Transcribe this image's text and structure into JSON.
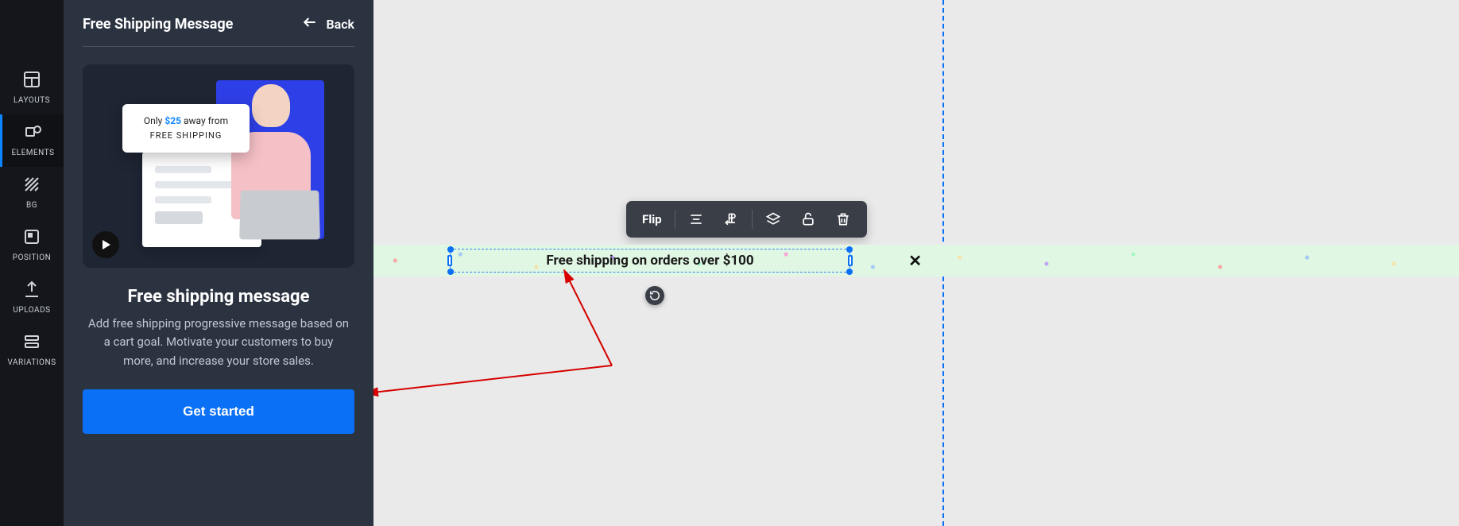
{
  "rail": {
    "items": [
      {
        "label": "LAYOUTS"
      },
      {
        "label": "ELEMENTS"
      },
      {
        "label": "BG"
      },
      {
        "label": "POSITION"
      },
      {
        "label": "UPLOADS"
      },
      {
        "label": "VARIATIONS"
      }
    ]
  },
  "panel": {
    "title": "Free Shipping Message",
    "back_label": "Back",
    "preview_tooltip_prefix": "Only ",
    "preview_tooltip_amount": "$25",
    "preview_tooltip_suffix": " away from",
    "preview_tooltip_line2": "FREE SHIPPING",
    "heading": "Free shipping message",
    "description": "Add free shipping progressive message based on a cart goal. Motivate your customers to buy more, and increase your store sales.",
    "cta": "Get started"
  },
  "toolbar": {
    "flip": "Flip"
  },
  "banner": {
    "text": "Free shipping on orders over $100",
    "close": "✕"
  }
}
